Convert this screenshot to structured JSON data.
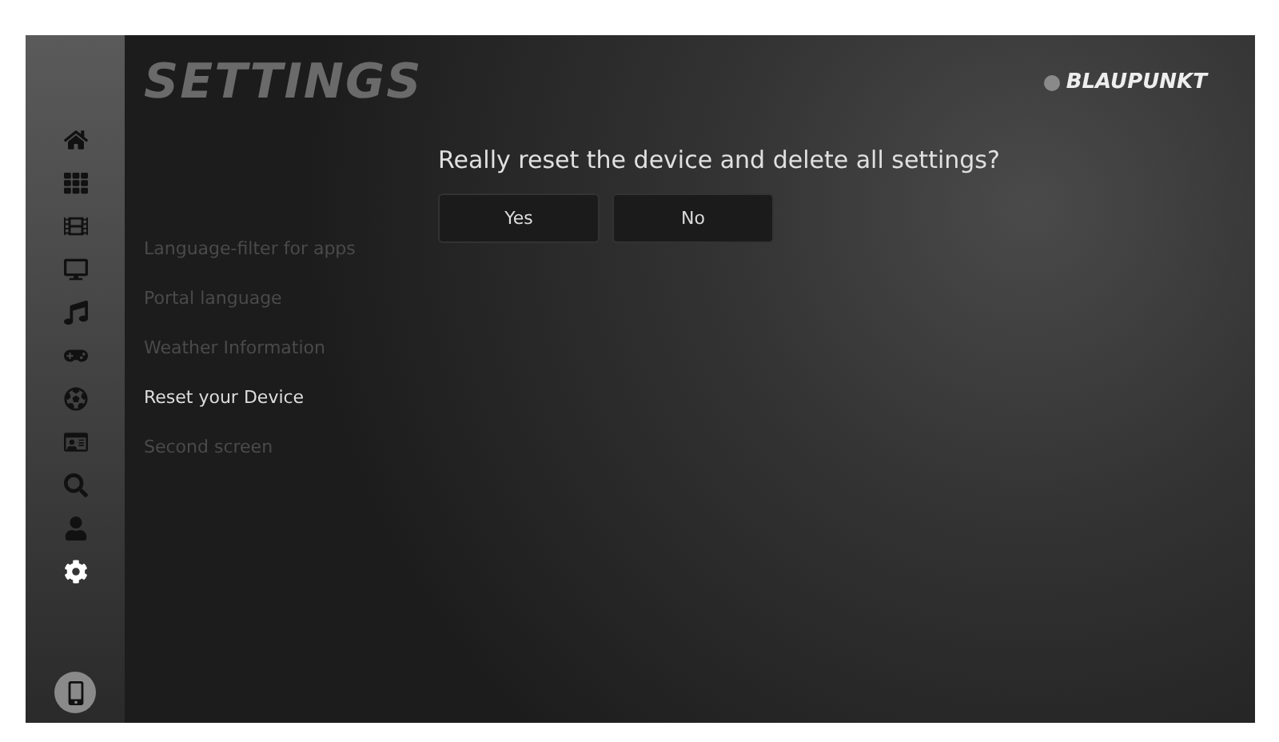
{
  "sidebar": {
    "items": [
      {
        "kind": "home",
        "selected": false
      },
      {
        "kind": "grid",
        "selected": false
      },
      {
        "kind": "film",
        "selected": false
      },
      {
        "kind": "tv",
        "selected": false
      },
      {
        "kind": "music",
        "selected": false
      },
      {
        "kind": "gamepad",
        "selected": false
      },
      {
        "kind": "ball",
        "selected": false
      },
      {
        "kind": "panel",
        "selected": false
      },
      {
        "kind": "search",
        "selected": false
      },
      {
        "kind": "user",
        "selected": false
      },
      {
        "kind": "settings",
        "selected": true
      }
    ],
    "device_button": {
      "kind": "phone"
    }
  },
  "title": "SETTINGS",
  "logo": "BLAUPUNKT",
  "menu": [
    {
      "label": "Language-filter for apps",
      "selected": false
    },
    {
      "label": "Portal language",
      "selected": false
    },
    {
      "label": "Weather Information",
      "selected": false
    },
    {
      "label": "Reset your Device",
      "selected": true
    },
    {
      "label": "Second screen",
      "selected": false
    }
  ],
  "dialog": {
    "question": "Really reset the device and delete all settings?",
    "buttons": [
      "Yes",
      "No"
    ]
  }
}
